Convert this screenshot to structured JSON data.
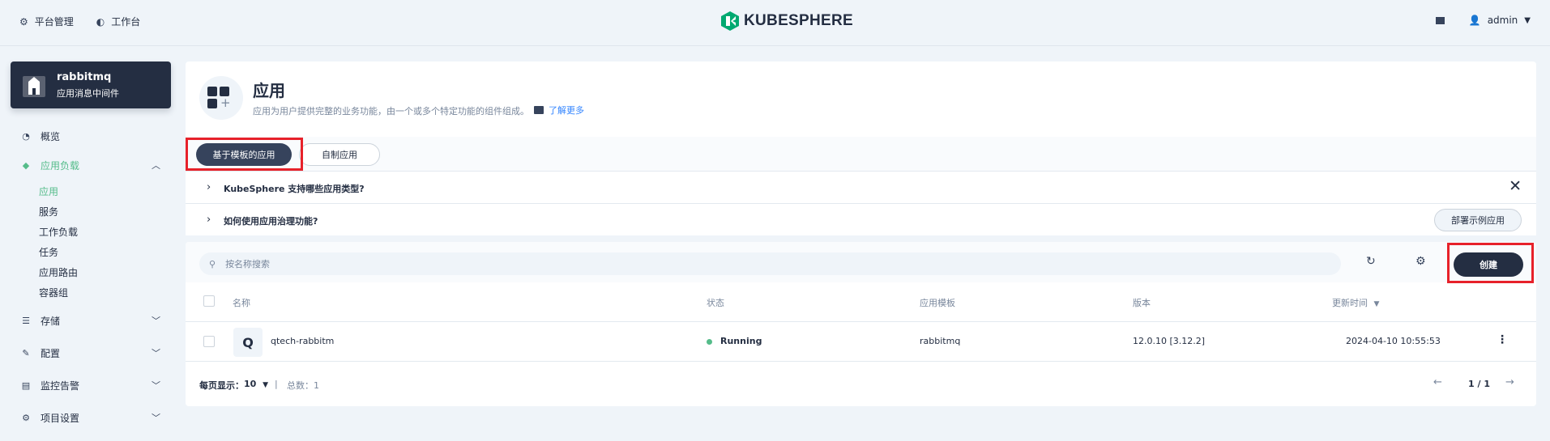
{
  "nav": {
    "platform": "平台管理",
    "workbench": "工作台",
    "brand": "KUBESPHERE",
    "user": "admin"
  },
  "project": {
    "name": "rabbitmq",
    "desc": "应用消息中间件"
  },
  "sidebar": {
    "overview": "概览",
    "workloads_group": "应用负载",
    "items": [
      "应用",
      "服务",
      "工作负载",
      "任务",
      "应用路由",
      "容器组"
    ],
    "storage": "存储",
    "config": "配置",
    "monitoring": "监控告警",
    "settings": "项目设置"
  },
  "header": {
    "title": "应用",
    "desc": "应用为用户提供完整的业务功能，由一个或多个特定功能的组件组成。",
    "learn_more": "了解更多"
  },
  "tabs": {
    "template": "基于模板的应用",
    "custom": "自制应用"
  },
  "faq": {
    "q1": "KubeSphere 支持哪些应用类型?",
    "q2": "如何使用应用治理功能?",
    "demo_button": "部署示例应用"
  },
  "toolbar": {
    "search_placeholder": "按名称搜索",
    "create": "创建"
  },
  "table": {
    "headers": {
      "name": "名称",
      "status": "状态",
      "template": "应用模板",
      "version": "版本",
      "updated": "更新时间"
    },
    "rows": [
      {
        "icon_letter": "Q",
        "name": "qtech-rabbitm",
        "status": "Running",
        "template": "rabbitmq",
        "version": "12.0.10 [3.12.2]",
        "updated": "2024-04-10 10:55:53"
      }
    ]
  },
  "pager": {
    "per_page_label": "每页显示：",
    "per_page": "10",
    "total": "总数：1",
    "page": "1 / 1"
  },
  "colors": {
    "accent": "#55bc8a",
    "dark": "#242e42",
    "highlight": "#e7212a"
  }
}
